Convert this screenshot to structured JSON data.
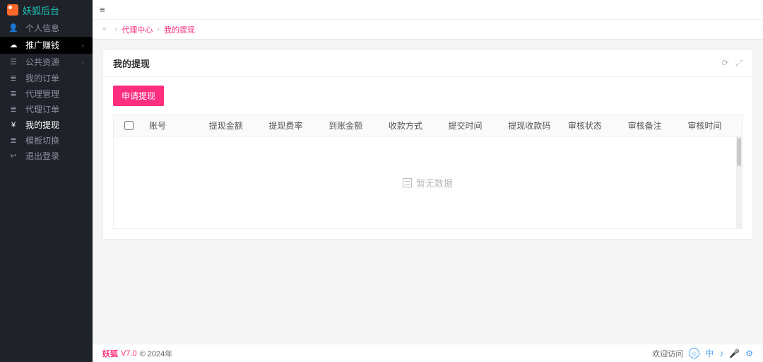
{
  "app": {
    "title": "妖狐后台"
  },
  "sidebar": {
    "items": [
      {
        "icon": "👤",
        "label": "个人信息"
      },
      {
        "icon": "☁",
        "label": "推广赚钱",
        "arrow": true,
        "active": true
      },
      {
        "icon": "☰",
        "label": "公共资源",
        "arrow": true
      },
      {
        "icon": "≣",
        "label": "我的订单"
      },
      {
        "icon": "≣",
        "label": "代理管理"
      },
      {
        "icon": "≣",
        "label": "代理订单"
      },
      {
        "icon": "¥",
        "label": "我的提现",
        "current": true
      },
      {
        "icon": "≣",
        "label": "模板切换"
      },
      {
        "icon": "↩",
        "label": "退出登录"
      }
    ]
  },
  "breadcrumb": {
    "items": [
      "代理中心",
      "我的提现"
    ]
  },
  "card": {
    "title": "我的提现",
    "apply_label": "申请提现"
  },
  "table": {
    "columns": [
      "账号",
      "提现金额",
      "提现费率",
      "到账金额",
      "收款方式",
      "提交时间",
      "提现收款码",
      "审核状态",
      "审核备注",
      "审核时间"
    ],
    "no_data": "暂无数据"
  },
  "footer": {
    "brand": "妖狐",
    "version": "V7.0",
    "year": "© 2024年",
    "welcome": "欢迎访问"
  }
}
